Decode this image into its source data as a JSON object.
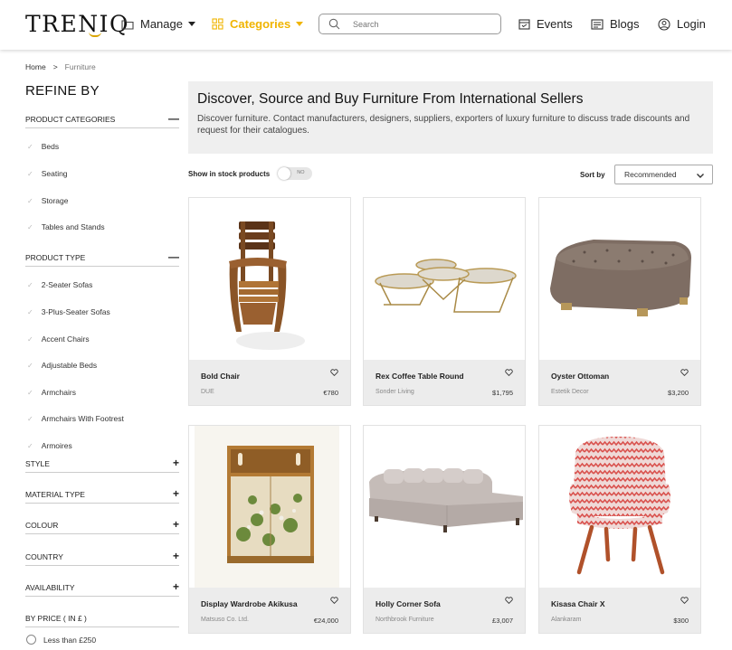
{
  "header": {
    "logo": "TRENΙQ",
    "manage": "Manage",
    "categories": "Categories",
    "search_placeholder": "Search",
    "events": "Events",
    "blogs": "Blogs",
    "login": "Login",
    "accent_color": "#f0b400"
  },
  "breadcrumb": {
    "home": "Home",
    "sep": ">",
    "current": "Furniture"
  },
  "sidebar": {
    "title": "REFINE BY",
    "product_categories": {
      "title": "PRODUCT CATEGORIES",
      "items": [
        "Beds",
        "Seating",
        "Storage",
        "Tables and Stands"
      ]
    },
    "product_type": {
      "title": "PRODUCT TYPE",
      "items": [
        "2-Seater Sofas",
        "3-Plus-Seater Sofas",
        "Accent Chairs",
        "Adjustable Beds",
        "Armchairs",
        "Armchairs With Footrest",
        "Armoires"
      ]
    },
    "collapsed_sections": [
      "STYLE",
      "MATERIAL TYPE",
      "COLOUR",
      "COUNTRY",
      "AVAILABILITY"
    ],
    "price": {
      "title": "BY PRICE ( IN £ )",
      "first_option": "Less than £250"
    }
  },
  "banner": {
    "title": "Discover, Source and Buy Furniture From International Sellers",
    "text": "Discover furniture. Contact manufacturers, designers, suppliers, exporters of luxury furniture to discuss trade discounts and request for their catalogues."
  },
  "filters": {
    "stock_label": "Show in stock products",
    "stock_toggle": "NO",
    "sort_label": "Sort by",
    "sort_value": "Recommended"
  },
  "products": [
    {
      "name": "Bold Chair",
      "seller": "DUE",
      "price": "€780",
      "icon": "wooden-chair"
    },
    {
      "name": "Rex Coffee Table Round",
      "seller": "Sonder Living",
      "price": "$1,795",
      "icon": "nesting-coffee-tables"
    },
    {
      "name": "Oyster Ottoman",
      "seller": "Estetik Decor",
      "price": "$3,200",
      "icon": "tufted-ottoman"
    },
    {
      "name": "Display Wardrobe Akikusa",
      "seller": "Matsuso Co. Ltd.",
      "price": "€24,000",
      "icon": "painted-cabinet"
    },
    {
      "name": "Holly Corner Sofa",
      "seller": "Northbrook Furniture",
      "price": "£3,007",
      "icon": "corner-sofa"
    },
    {
      "name": "Kisasa Chair X",
      "seller": "Alankaram",
      "price": "$300",
      "icon": "zigzag-armchair"
    }
  ]
}
